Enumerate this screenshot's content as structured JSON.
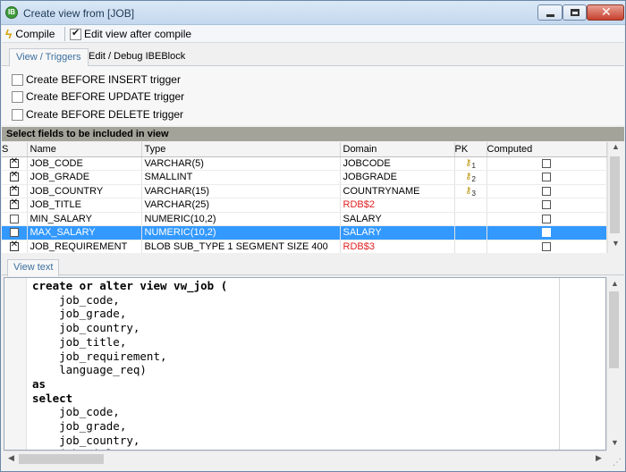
{
  "window": {
    "title": "Create view from [JOB]",
    "icon": "ibexpert-app-icon",
    "close_glyph": "✕"
  },
  "toolbar": {
    "compile_label": "Compile",
    "edit_after_compile_label": "Edit view after compile",
    "edit_after_compile_checked": true
  },
  "tabs": {
    "view_triggers": "View / Triggers",
    "edit_debug": "Edit / Debug IBEBlock"
  },
  "triggers": [
    {
      "label": "Create BEFORE INSERT trigger",
      "checked": false
    },
    {
      "label": "Create BEFORE UPDATE trigger",
      "checked": false
    },
    {
      "label": "Create BEFORE DELETE trigger",
      "checked": false
    }
  ],
  "fields_grid": {
    "title": "Select fields to be included in view",
    "columns": [
      "S",
      "Name",
      "Type",
      "Domain",
      "PK",
      "Computed"
    ],
    "rows": [
      {
        "s": true,
        "name": "JOB_CODE",
        "type": "VARCHAR(5)",
        "domain": "JOBCODE",
        "domain_red": false,
        "pk": "1",
        "computed": false,
        "selected": false
      },
      {
        "s": true,
        "name": "JOB_GRADE",
        "type": "SMALLINT",
        "domain": "JOBGRADE",
        "domain_red": false,
        "pk": "2",
        "computed": false,
        "selected": false
      },
      {
        "s": true,
        "name": "JOB_COUNTRY",
        "type": "VARCHAR(15)",
        "domain": "COUNTRYNAME",
        "domain_red": false,
        "pk": "3",
        "computed": false,
        "selected": false
      },
      {
        "s": true,
        "name": "JOB_TITLE",
        "type": "VARCHAR(25)",
        "domain": "RDB$2",
        "domain_red": true,
        "pk": "",
        "computed": false,
        "selected": false
      },
      {
        "s": false,
        "name": "MIN_SALARY",
        "type": "NUMERIC(10,2)",
        "domain": "SALARY",
        "domain_red": false,
        "pk": "",
        "computed": false,
        "selected": false
      },
      {
        "s": false,
        "name": "MAX_SALARY",
        "type": "NUMERIC(10,2)",
        "domain": "SALARY",
        "domain_red": false,
        "pk": "",
        "computed": false,
        "selected": true
      },
      {
        "s": true,
        "name": "JOB_REQUIREMENT",
        "type": "BLOB SUB_TYPE 1 SEGMENT SIZE 400",
        "domain": "RDB$3",
        "domain_red": true,
        "pk": "",
        "computed": false,
        "selected": false
      }
    ]
  },
  "view_text_tab": "View text",
  "code_lines": [
    "create or alter view vw_job (",
    "    job_code,",
    "    job_grade,",
    "    job_country,",
    "    job_title,",
    "    job_requirement,",
    "    language_req)",
    "as",
    "select",
    "    job_code,",
    "    job_grade,",
    "    job_country,",
    "    job_title,"
  ],
  "colors": {
    "selection": "#3399ff",
    "red_domain": "#e02020",
    "grid_header": "#a3a39a"
  }
}
